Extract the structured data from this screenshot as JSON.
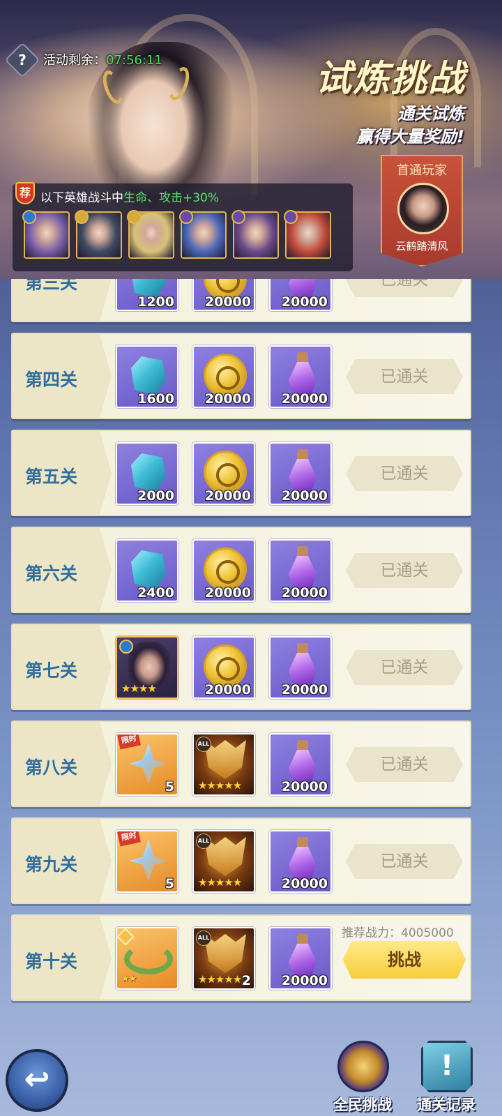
{
  "header": {
    "help_icon": "?",
    "timer_label": "活动剩余：",
    "timer_value": "07:56:11",
    "title": "试炼挑战",
    "subtitle_line1": "通关试炼",
    "subtitle_line2": "赢得大量奖励!",
    "first_clear": {
      "title": "首通玩家",
      "name": "云鹤踏清风"
    },
    "buff": {
      "badge": "荐",
      "text_prefix": "以下英雄战斗中",
      "text_highlight": "生命、攻击+30%",
      "heroes": [
        {
          "element": "water",
          "color": "#7b5fa8"
        },
        {
          "element": "light",
          "color": "#3f4a62"
        },
        {
          "element": "light",
          "color": "#d8c27a"
        },
        {
          "element": "dark",
          "color": "#4a66b8"
        },
        {
          "element": "dark",
          "color": "#6a4a8a"
        },
        {
          "element": "dark",
          "color": "#c24a3a"
        }
      ]
    }
  },
  "stages": [
    {
      "name": "第三关",
      "rewards": [
        {
          "type": "gem",
          "qty": "1200"
        },
        {
          "type": "coin",
          "qty": "20000"
        },
        {
          "type": "potion",
          "qty": "20000"
        }
      ],
      "status": "已通关"
    },
    {
      "name": "第四关",
      "rewards": [
        {
          "type": "gem",
          "qty": "1600"
        },
        {
          "type": "coin",
          "qty": "20000"
        },
        {
          "type": "potion",
          "qty": "20000"
        }
      ],
      "status": "已通关"
    },
    {
      "name": "第五关",
      "rewards": [
        {
          "type": "gem",
          "qty": "2000"
        },
        {
          "type": "coin",
          "qty": "20000"
        },
        {
          "type": "potion",
          "qty": "20000"
        }
      ],
      "status": "已通关"
    },
    {
      "name": "第六关",
      "rewards": [
        {
          "type": "gem",
          "qty": "2400"
        },
        {
          "type": "coin",
          "qty": "20000"
        },
        {
          "type": "potion",
          "qty": "20000"
        }
      ],
      "status": "已通关"
    },
    {
      "name": "第七关",
      "rewards": [
        {
          "type": "hero",
          "stars": "★★★★"
        },
        {
          "type": "coin",
          "qty": "20000"
        },
        {
          "type": "potion",
          "qty": "20000"
        }
      ],
      "status": "已通关"
    },
    {
      "name": "第八关",
      "rewards": [
        {
          "type": "blade",
          "tag": "限时",
          "qty": "5"
        },
        {
          "type": "mask",
          "tag": "ALL",
          "stars": "★★★★★"
        },
        {
          "type": "potion",
          "qty": "20000"
        }
      ],
      "status": "已通关"
    },
    {
      "name": "第九关",
      "rewards": [
        {
          "type": "blade",
          "tag": "限时",
          "qty": "5"
        },
        {
          "type": "mask",
          "tag": "ALL",
          "stars": "★★★★★"
        },
        {
          "type": "potion",
          "qty": "20000"
        }
      ],
      "status": "已通关"
    },
    {
      "name": "第十关",
      "rewards": [
        {
          "type": "wreath",
          "stars": "★★"
        },
        {
          "type": "mask",
          "tag": "ALL",
          "stars": "★★★★★",
          "qty": "2"
        },
        {
          "type": "potion",
          "qty": "20000"
        }
      ],
      "recommend_label": "推荐战力：",
      "recommend_value": "4005000",
      "action": "挑战"
    }
  ],
  "footer": {
    "back_icon": "↩",
    "btn1_label": "全民挑战",
    "btn2_label": "通关记录",
    "btn2_glyph": "!"
  }
}
